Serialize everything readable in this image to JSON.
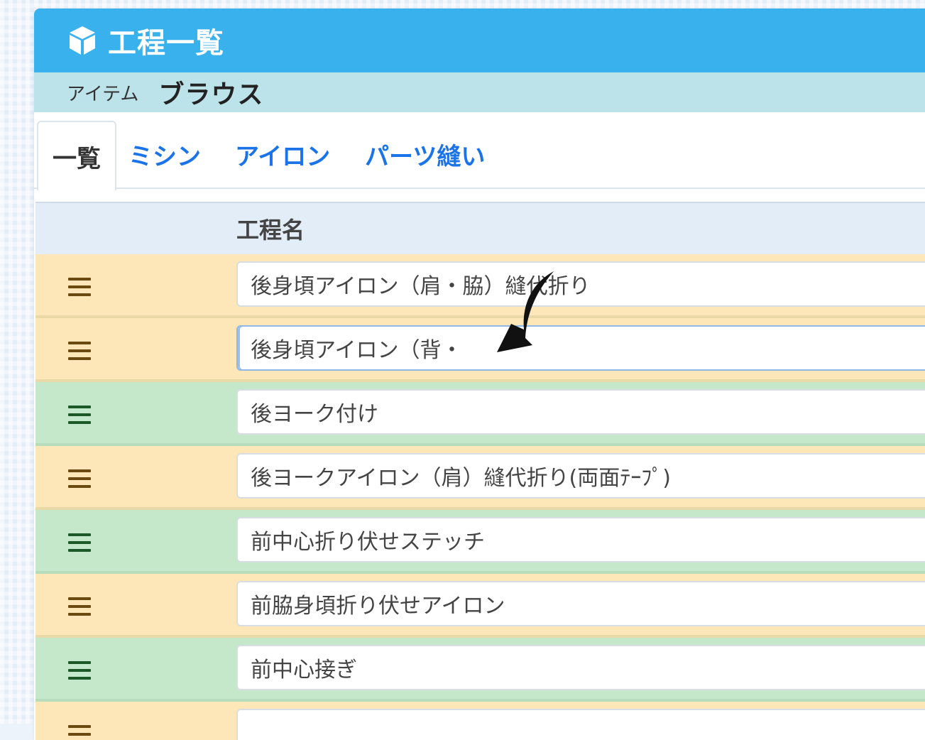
{
  "header": {
    "title": "工程一覧",
    "icon": "cube-icon",
    "color": "#39b1ec"
  },
  "item": {
    "label": "アイテム",
    "value": "ブラウス"
  },
  "tabs": [
    {
      "label": "一覧",
      "active": true
    },
    {
      "label": "ミシン",
      "active": false
    },
    {
      "label": "アイロン",
      "active": false
    },
    {
      "label": "パーツ縫い",
      "active": false
    }
  ],
  "table": {
    "header": "工程名",
    "rows": [
      {
        "name": "後身頃アイロン（肩・脇）縫代折り",
        "color": "yellow"
      },
      {
        "name": "後身頃アイロン（背・",
        "color": "yellow"
      },
      {
        "name": "後ヨーク付け",
        "color": "green"
      },
      {
        "name": "後ヨークアイロン（肩）縫代折り(両面ﾃｰﾌﾟ)",
        "color": "yellow"
      },
      {
        "name": "前中心折り伏せステッチ",
        "color": "green"
      },
      {
        "name": "前脇身頃折り伏せアイロン",
        "color": "yellow"
      },
      {
        "name": "前中心接ぎ",
        "color": "green"
      },
      {
        "name": "",
        "color": "yellow"
      }
    ]
  },
  "colors": {
    "yellow_row": "#fde7b8",
    "green_row": "#c5e8cb",
    "tab_link": "#1a73e8"
  }
}
